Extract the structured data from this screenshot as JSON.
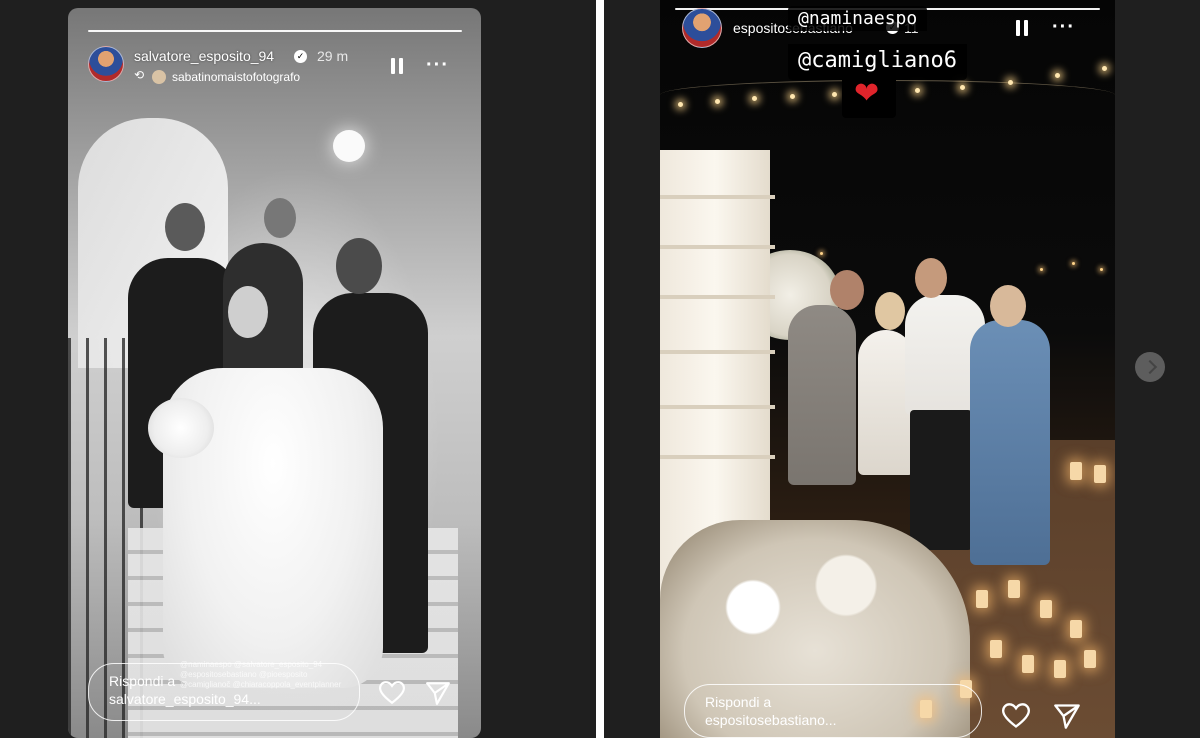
{
  "left_story": {
    "username": "salvatore_esposito_94",
    "time_ago": "29 m",
    "reposted_from": "sabatinomaistofotografo",
    "mentions": [
      "@naminaespo @salvatore_esposito_94",
      "@espositosebastiano @pioesposito",
      "@camiglianoč @chiaracoppola_eventplanner"
    ],
    "reply_prefix": "Rispondi a",
    "reply_user": "salvatore_esposito_94..."
  },
  "right_story": {
    "username": "espositosebastiano",
    "time_ago": "11",
    "tag_1": "@naminaespo",
    "tag_2": "@camigliano6",
    "heart_sticker": "❤",
    "reply_prefix": "Rispondi a",
    "reply_user": "espositosebastiano..."
  },
  "icons": {
    "verified": "verified-badge-icon",
    "pause": "pause-icon",
    "more": "more-options-icon",
    "heart": "heart-icon",
    "send": "send-icon",
    "repost": "repost-icon",
    "next": "chevron-right-icon"
  },
  "colors": {
    "page_background": "#1f1f1f",
    "divider": "#ffffff",
    "heart_sticker": "#e0242b"
  }
}
